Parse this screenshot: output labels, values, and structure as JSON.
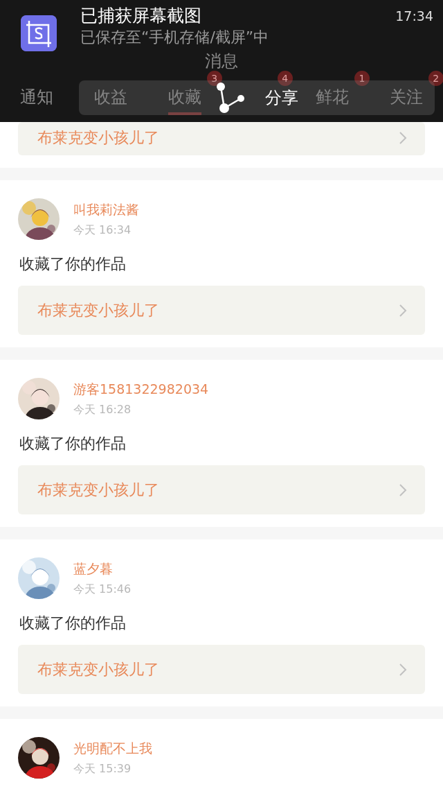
{
  "notification": {
    "title": "已捕获屏幕截图",
    "subtitle": "已保存至“手机存储/截屏”中",
    "time": "17:34",
    "share_label": "分享"
  },
  "app_header": {
    "title": "消息",
    "tabs": [
      {
        "label": "通知",
        "selected": false
      },
      {
        "label": "收益",
        "selected": false
      },
      {
        "label": "收藏",
        "selected": true,
        "badge": "3"
      },
      {
        "selected": false,
        "badge": "4"
      },
      {
        "label": "鲜花",
        "selected": false,
        "badge": "1"
      },
      {
        "label": "关注",
        "selected": false,
        "badge": "2"
      }
    ]
  },
  "feed": [
    {
      "kind": "partial_top",
      "work": "布莱克变小孩儿了"
    },
    {
      "kind": "full",
      "user": "叫我莉法酱",
      "time": "今天 16:34",
      "action": "收藏了你的作品",
      "work": "布莱克变小孩儿了"
    },
    {
      "kind": "full",
      "user": "游客1581322982034",
      "time": "今天 16:28",
      "action": "收藏了你的作品",
      "work": "布莱克变小孩儿了"
    },
    {
      "kind": "full",
      "user": "蓝夕暮",
      "time": "今天 15:46",
      "action": "收藏了你的作品",
      "work": "布莱克变小孩儿了"
    },
    {
      "kind": "partial_bottom",
      "user": "光明配不上我",
      "time": "今天 15:39"
    }
  ]
}
